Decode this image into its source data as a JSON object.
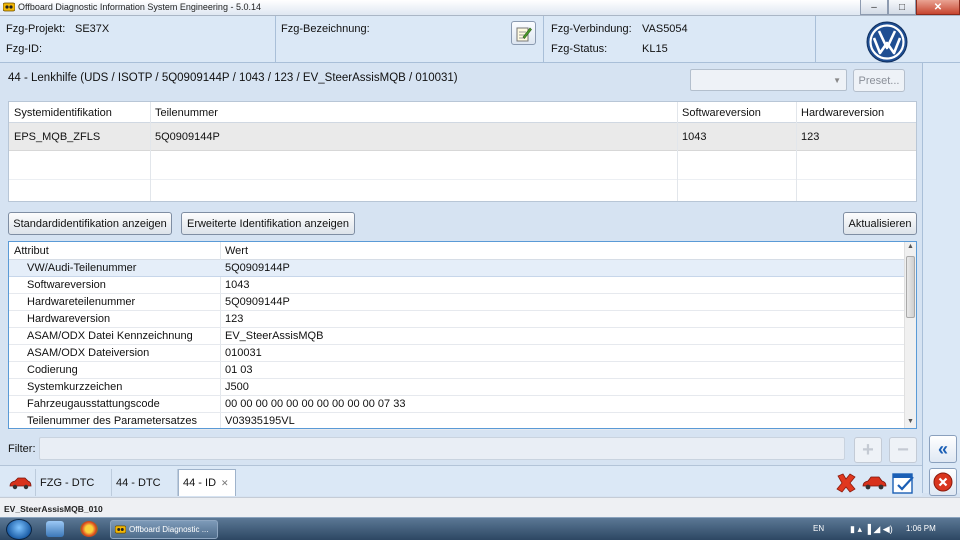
{
  "window": {
    "title": "Offboard Diagnostic Information System Engineering - 5.0.14",
    "minimize": "–",
    "maximize": "□",
    "close": "✕"
  },
  "header": {
    "projekt_label": "Fzg-Projekt:",
    "projekt_value": "SE37X",
    "id_label": "Fzg-ID:",
    "bezeichnung_label": "Fzg-Bezeichnung:",
    "verbindung_label": "Fzg-Verbindung:",
    "verbindung_value": "VAS5054",
    "status_label": "Fzg-Status:",
    "status_value": "KL15"
  },
  "module": {
    "line": "44 - Lenkhilfe  (UDS / ISOTP / 5Q0909144P  / 1043 / 123 / EV_SteerAssisMQB / 010031)",
    "preset_label": "Preset..."
  },
  "sysident": {
    "columns": [
      "Systemidentifikation",
      "Teilenummer",
      "Softwareversion",
      "Hardwareversion"
    ],
    "rows": [
      [
        "EPS_MQB_ZFLS",
        "5Q0909144P",
        "1043",
        "123"
      ]
    ]
  },
  "buttons": {
    "standard": "Standardidentifikation anzeigen",
    "extended": "Erweiterte Identifikation anzeigen",
    "refresh": "Aktualisieren"
  },
  "attributes": {
    "col_attr": "Attribut",
    "col_value": "Wert",
    "rows": [
      {
        "a": "VW/Audi-Teilenummer",
        "v": "5Q0909144P"
      },
      {
        "a": "Softwareversion",
        "v": "1043"
      },
      {
        "a": "Hardwareteilenummer",
        "v": "5Q0909144P"
      },
      {
        "a": "Hardwareversion",
        "v": "123"
      },
      {
        "a": "ASAM/ODX Datei Kennzeichnung",
        "v": "EV_SteerAssisMQB"
      },
      {
        "a": "ASAM/ODX Dateiversion",
        "v": "010031"
      },
      {
        "a": "Codierung",
        "v": "01 03"
      },
      {
        "a": "Systemkurzzeichen",
        "v": "J500"
      },
      {
        "a": "Fahrzeugausstattungscode",
        "v": "00 00 00 00 00 00 00 00 00 00 07 33"
      },
      {
        "a": "Teilenummer des Parametersatzes",
        "v": "V03935195VL"
      }
    ]
  },
  "filter": {
    "label": "Filter:",
    "value": "",
    "add": "+",
    "remove": "−"
  },
  "tabs": [
    {
      "label": "FZG - DTC"
    },
    {
      "label": "44 - DTC"
    },
    {
      "label": "44 - ID",
      "close": "✕"
    }
  ],
  "side": {
    "collapse": "«",
    "exit": "✕"
  },
  "statusbar": {
    "text": "EV_SteerAssisMQB_010"
  },
  "taskbar": {
    "task_label": "Offboard Diagnostic ...",
    "lang": "EN",
    "time": "1:06 PM"
  },
  "colors": {
    "accent_blue": "#5a9ad6",
    "selected_row": "#e5eef9",
    "header_bg": "#dbe8f6"
  }
}
